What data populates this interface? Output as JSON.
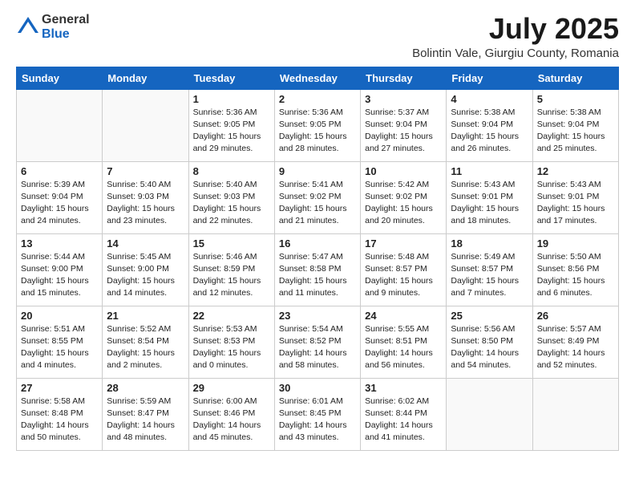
{
  "header": {
    "logo_line1": "General",
    "logo_line2": "Blue",
    "month_year": "July 2025",
    "location": "Bolintin Vale, Giurgiu County, Romania"
  },
  "weekdays": [
    "Sunday",
    "Monday",
    "Tuesday",
    "Wednesday",
    "Thursday",
    "Friday",
    "Saturday"
  ],
  "weeks": [
    [
      {
        "day": "",
        "sunrise": "",
        "sunset": "",
        "daylight": ""
      },
      {
        "day": "",
        "sunrise": "",
        "sunset": "",
        "daylight": ""
      },
      {
        "day": "1",
        "sunrise": "Sunrise: 5:36 AM",
        "sunset": "Sunset: 9:05 PM",
        "daylight": "Daylight: 15 hours and 29 minutes."
      },
      {
        "day": "2",
        "sunrise": "Sunrise: 5:36 AM",
        "sunset": "Sunset: 9:05 PM",
        "daylight": "Daylight: 15 hours and 28 minutes."
      },
      {
        "day": "3",
        "sunrise": "Sunrise: 5:37 AM",
        "sunset": "Sunset: 9:04 PM",
        "daylight": "Daylight: 15 hours and 27 minutes."
      },
      {
        "day": "4",
        "sunrise": "Sunrise: 5:38 AM",
        "sunset": "Sunset: 9:04 PM",
        "daylight": "Daylight: 15 hours and 26 minutes."
      },
      {
        "day": "5",
        "sunrise": "Sunrise: 5:38 AM",
        "sunset": "Sunset: 9:04 PM",
        "daylight": "Daylight: 15 hours and 25 minutes."
      }
    ],
    [
      {
        "day": "6",
        "sunrise": "Sunrise: 5:39 AM",
        "sunset": "Sunset: 9:04 PM",
        "daylight": "Daylight: 15 hours and 24 minutes."
      },
      {
        "day": "7",
        "sunrise": "Sunrise: 5:40 AM",
        "sunset": "Sunset: 9:03 PM",
        "daylight": "Daylight: 15 hours and 23 minutes."
      },
      {
        "day": "8",
        "sunrise": "Sunrise: 5:40 AM",
        "sunset": "Sunset: 9:03 PM",
        "daylight": "Daylight: 15 hours and 22 minutes."
      },
      {
        "day": "9",
        "sunrise": "Sunrise: 5:41 AM",
        "sunset": "Sunset: 9:02 PM",
        "daylight": "Daylight: 15 hours and 21 minutes."
      },
      {
        "day": "10",
        "sunrise": "Sunrise: 5:42 AM",
        "sunset": "Sunset: 9:02 PM",
        "daylight": "Daylight: 15 hours and 20 minutes."
      },
      {
        "day": "11",
        "sunrise": "Sunrise: 5:43 AM",
        "sunset": "Sunset: 9:01 PM",
        "daylight": "Daylight: 15 hours and 18 minutes."
      },
      {
        "day": "12",
        "sunrise": "Sunrise: 5:43 AM",
        "sunset": "Sunset: 9:01 PM",
        "daylight": "Daylight: 15 hours and 17 minutes."
      }
    ],
    [
      {
        "day": "13",
        "sunrise": "Sunrise: 5:44 AM",
        "sunset": "Sunset: 9:00 PM",
        "daylight": "Daylight: 15 hours and 15 minutes."
      },
      {
        "day": "14",
        "sunrise": "Sunrise: 5:45 AM",
        "sunset": "Sunset: 9:00 PM",
        "daylight": "Daylight: 15 hours and 14 minutes."
      },
      {
        "day": "15",
        "sunrise": "Sunrise: 5:46 AM",
        "sunset": "Sunset: 8:59 PM",
        "daylight": "Daylight: 15 hours and 12 minutes."
      },
      {
        "day": "16",
        "sunrise": "Sunrise: 5:47 AM",
        "sunset": "Sunset: 8:58 PM",
        "daylight": "Daylight: 15 hours and 11 minutes."
      },
      {
        "day": "17",
        "sunrise": "Sunrise: 5:48 AM",
        "sunset": "Sunset: 8:57 PM",
        "daylight": "Daylight: 15 hours and 9 minutes."
      },
      {
        "day": "18",
        "sunrise": "Sunrise: 5:49 AM",
        "sunset": "Sunset: 8:57 PM",
        "daylight": "Daylight: 15 hours and 7 minutes."
      },
      {
        "day": "19",
        "sunrise": "Sunrise: 5:50 AM",
        "sunset": "Sunset: 8:56 PM",
        "daylight": "Daylight: 15 hours and 6 minutes."
      }
    ],
    [
      {
        "day": "20",
        "sunrise": "Sunrise: 5:51 AM",
        "sunset": "Sunset: 8:55 PM",
        "daylight": "Daylight: 15 hours and 4 minutes."
      },
      {
        "day": "21",
        "sunrise": "Sunrise: 5:52 AM",
        "sunset": "Sunset: 8:54 PM",
        "daylight": "Daylight: 15 hours and 2 minutes."
      },
      {
        "day": "22",
        "sunrise": "Sunrise: 5:53 AM",
        "sunset": "Sunset: 8:53 PM",
        "daylight": "Daylight: 15 hours and 0 minutes."
      },
      {
        "day": "23",
        "sunrise": "Sunrise: 5:54 AM",
        "sunset": "Sunset: 8:52 PM",
        "daylight": "Daylight: 14 hours and 58 minutes."
      },
      {
        "day": "24",
        "sunrise": "Sunrise: 5:55 AM",
        "sunset": "Sunset: 8:51 PM",
        "daylight": "Daylight: 14 hours and 56 minutes."
      },
      {
        "day": "25",
        "sunrise": "Sunrise: 5:56 AM",
        "sunset": "Sunset: 8:50 PM",
        "daylight": "Daylight: 14 hours and 54 minutes."
      },
      {
        "day": "26",
        "sunrise": "Sunrise: 5:57 AM",
        "sunset": "Sunset: 8:49 PM",
        "daylight": "Daylight: 14 hours and 52 minutes."
      }
    ],
    [
      {
        "day": "27",
        "sunrise": "Sunrise: 5:58 AM",
        "sunset": "Sunset: 8:48 PM",
        "daylight": "Daylight: 14 hours and 50 minutes."
      },
      {
        "day": "28",
        "sunrise": "Sunrise: 5:59 AM",
        "sunset": "Sunset: 8:47 PM",
        "daylight": "Daylight: 14 hours and 48 minutes."
      },
      {
        "day": "29",
        "sunrise": "Sunrise: 6:00 AM",
        "sunset": "Sunset: 8:46 PM",
        "daylight": "Daylight: 14 hours and 45 minutes."
      },
      {
        "day": "30",
        "sunrise": "Sunrise: 6:01 AM",
        "sunset": "Sunset: 8:45 PM",
        "daylight": "Daylight: 14 hours and 43 minutes."
      },
      {
        "day": "31",
        "sunrise": "Sunrise: 6:02 AM",
        "sunset": "Sunset: 8:44 PM",
        "daylight": "Daylight: 14 hours and 41 minutes."
      },
      {
        "day": "",
        "sunrise": "",
        "sunset": "",
        "daylight": ""
      },
      {
        "day": "",
        "sunrise": "",
        "sunset": "",
        "daylight": ""
      }
    ]
  ]
}
